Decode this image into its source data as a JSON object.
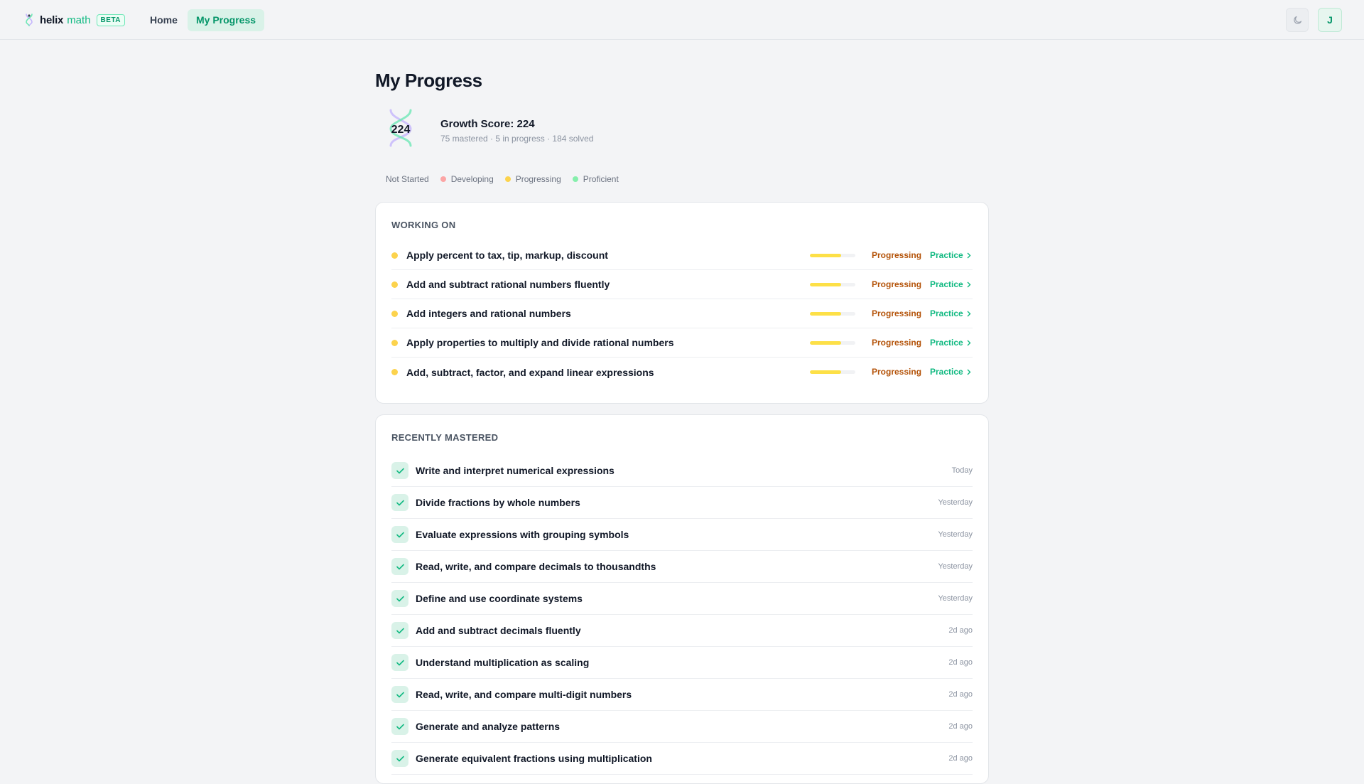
{
  "app": {
    "brand_helix": "helix",
    "brand_math": "math",
    "badge": "BETA",
    "nav": {
      "home": "Home",
      "progress": "My Progress"
    },
    "user_initial": "J",
    "accent_color": "#10b981"
  },
  "page": {
    "title": "My Progress",
    "score_value": "224",
    "score_title": "Growth Score: 224",
    "score_sub": "75 mastered · 5 in progress · 184 solved"
  },
  "legend": [
    {
      "label": "Not Started",
      "color": "#f3f4f6"
    },
    {
      "label": "Developing",
      "color": "#fca5a5"
    },
    {
      "label": "Progressing",
      "color": "#fcd34d"
    },
    {
      "label": "Proficient",
      "color": "#86efac"
    }
  ],
  "working_on": {
    "heading": "WORKING ON",
    "items": [
      {
        "label": "Apply percent to tax, tip, markup, discount",
        "status": "Progressing",
        "action": "Practice",
        "progress": 0.68
      },
      {
        "label": "Add and subtract rational numbers fluently",
        "status": "Progressing",
        "action": "Practice",
        "progress": 0.68
      },
      {
        "label": "Add integers and rational numbers",
        "status": "Progressing",
        "action": "Practice",
        "progress": 0.68
      },
      {
        "label": "Apply properties to multiply and divide rational numbers",
        "status": "Progressing",
        "action": "Practice",
        "progress": 0.68
      },
      {
        "label": "Add, subtract, factor, and expand linear expressions",
        "status": "Progressing",
        "action": "Practice",
        "progress": 0.68
      }
    ]
  },
  "recently_mastered": {
    "heading": "RECENTLY MASTERED",
    "items": [
      {
        "label": "Write and interpret numerical expressions",
        "time": "Today"
      },
      {
        "label": "Divide fractions by whole numbers",
        "time": "Yesterday"
      },
      {
        "label": "Evaluate expressions with grouping symbols",
        "time": "Yesterday"
      },
      {
        "label": "Read, write, and compare decimals to thousandths",
        "time": "Yesterday"
      },
      {
        "label": "Define and use coordinate systems",
        "time": "Yesterday"
      },
      {
        "label": "Add and subtract decimals fluently",
        "time": "2d ago"
      },
      {
        "label": "Understand multiplication as scaling",
        "time": "2d ago"
      },
      {
        "label": "Read, write, and compare multi-digit numbers",
        "time": "2d ago"
      },
      {
        "label": "Generate and analyze patterns",
        "time": "2d ago"
      },
      {
        "label": "Generate equivalent fractions using multiplication",
        "time": "2d ago"
      }
    ]
  }
}
